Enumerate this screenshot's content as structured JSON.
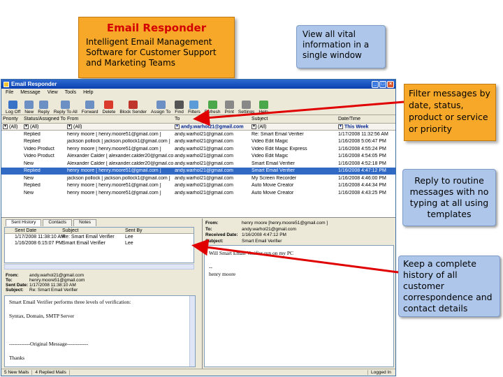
{
  "callouts": {
    "banner_title": "Email Responder",
    "banner_sub": "Intelligent Email Management Software for Customer Support and Marketing Teams",
    "view": "View all vital information in a single window",
    "filter": "Filter messages by date, status, product or service or priority",
    "reply": "Reply to routine messages with no typing at all using templates",
    "history": "Keep a complete history of all customer correspondence and contact details"
  },
  "window": {
    "title": "Email Responder",
    "menu": [
      "File",
      "Message",
      "View",
      "Tools",
      "Help"
    ],
    "toolbar": [
      "Log Off",
      "New",
      "Reply",
      "Reply To All",
      "Forward",
      "Delete",
      "Block Sender",
      "Assign To",
      "Find",
      "Filters",
      "Refresh",
      "Print",
      "Settings",
      "Help"
    ],
    "toolbar_colors": [
      "#3a72c8",
      "#6c8fc4",
      "#6c8fc4",
      "#6c8fc4",
      "#6c8fc4",
      "#d93a2b",
      "#c0352b",
      "#6c8fc4",
      "#555555",
      "#5a9bd8",
      "#4aa84a",
      "#888888",
      "#888888",
      "#4aa84a"
    ],
    "columns": [
      "Priority",
      "Status/Assigned To",
      "From",
      "To",
      "Subject",
      "Date/Time"
    ],
    "filters": [
      "(All)",
      "(All)",
      "(All)",
      "andy.warhol21@gmail.com",
      "(All)",
      "This Week"
    ],
    "rows": [
      [
        "",
        "Replied",
        "henry  moore [ henry.moore51@gmail.com ]",
        "andy.warhol21@gmail.com",
        "Re: Smart Email Verifier",
        "1/17/2008 11:32:56 AM"
      ],
      [
        "",
        "Replied",
        "jackson pollock [ jackson.pollock1@gmail.com ]",
        "andy.warhol21@gmail.com",
        "Video Edit Magic",
        "1/16/2008 5:06:47 PM"
      ],
      [
        "",
        "Video Product",
        "henry  moore [ henry.moore51@gmail.com ]",
        "andy.warhol21@gmail.com",
        "Video Edit Magic Express",
        "1/16/2008 4:55:24 PM"
      ],
      [
        "",
        "Video Product",
        "Alexander Calder [ alexander.calder20@gmail.com ]",
        "andy.warhol21@gmail.com",
        "Video Edit Magic",
        "1/16/2008 4:54:05 PM"
      ],
      [
        "",
        "New",
        "Alexander Calder [ alexander.calder20@gmail.com ]",
        "andy.warhol21@gmail.com",
        "Smart Email Verifier",
        "1/16/2008 4:52:18 PM"
      ],
      [
        "",
        "Replied",
        "henry  moore [ henry.moore51@gmail.com ]",
        "andy.warhol21@gmail.com",
        "Smart Email Verifier",
        "1/16/2008 4:47:12 PM"
      ],
      [
        "",
        "New",
        "jackson pollock [ jackson.pollock1@gmail.com ]",
        "andy.warhol21@gmail.com",
        "My Screen Recorder",
        "1/16/2008 4:46:00 PM"
      ],
      [
        "",
        "Replied",
        "henry  moore [ henry.moore51@gmail.com ]",
        "andy.warhol21@gmail.com",
        "Auto Movie Creator",
        "1/16/2008 4:44:34 PM"
      ],
      [
        "",
        "New",
        "henry  moore [ henry.moore51@gmail.com ]",
        "andy.warhol21@gmail.com",
        "Auto Movie Creator",
        "1/16/2008 4:43:25 PM"
      ]
    ],
    "selected_row": 5,
    "tabs": [
      "Sent History",
      "Contacts",
      "Notes"
    ],
    "history_columns": [
      "Sent Date",
      "Subject",
      "Sent By"
    ],
    "history_rows": [
      [
        "1/17/2008 11:38:10 AM",
        "Re: Smart Email Verifier",
        "Lee"
      ],
      [
        "1/16/2008 6:15:07 PM",
        "Smart Email Verifier",
        "Lee"
      ]
    ],
    "left_header": {
      "from_label": "From:",
      "from": "andy.warhol21@gmail.com",
      "to_label": "To:",
      "to": "henry.moore51@gmail.com",
      "date_label": "Sent Date:",
      "date": "1/17/2008 11:38:10 AM",
      "subject_label": "Subject:",
      "subject": "Re: Smart Email Verifier"
    },
    "left_body": [
      "Smart Email Verifier performs three levels of verification:",
      "",
      "Syntax, Domain, SMTP Server",
      "",
      "",
      "",
      "------------Original Message------------",
      "",
      "Thanks"
    ],
    "right_header": {
      "from_label": "From:",
      "from": "henry  moore [henry.moore51@gmail.com ]",
      "to_label": "To:",
      "to": "andy.warhol21@gmail.com",
      "date_label": "Received Date:",
      "date": "1/16/2008 4:47:12 PM",
      "subject_label": "Subject:",
      "subject": "Smart Email Verifier"
    },
    "right_body": [
      "Will Smart Email Verifier run on my PC",
      "",
      "--",
      "henry moore"
    ],
    "status": {
      "mails": "5 New Mails",
      "replied": "4 Replied Mails",
      "login": "Logged In"
    }
  }
}
